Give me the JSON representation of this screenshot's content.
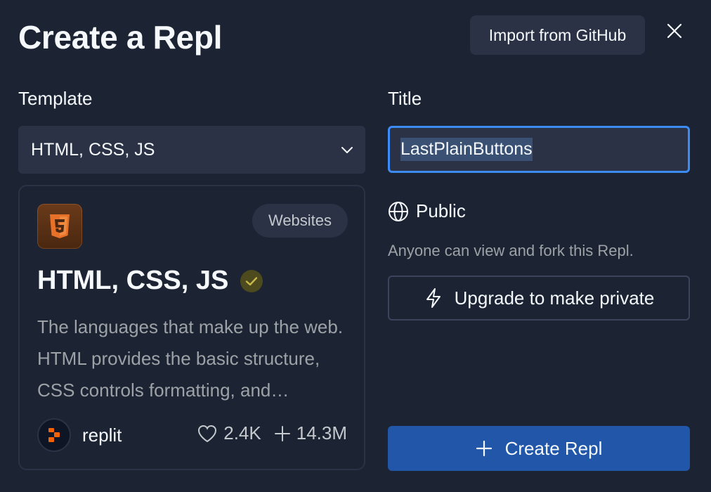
{
  "dialog": {
    "title": "Create a Repl",
    "import_label": "Import from GitHub",
    "close_icon": "close-icon"
  },
  "template": {
    "label": "Template",
    "selected": "HTML, CSS, JS"
  },
  "title_field": {
    "label": "Title",
    "value": "LastPlainButtons"
  },
  "card": {
    "icon": "html5-icon",
    "badge": "Websites",
    "name": "HTML, CSS, JS",
    "verified_icon": "verified-check-icon",
    "description": "The languages that make up the web. HTML provides the basic structure, CSS controls formatting, and JavaScript controls the behavior of different elements.",
    "author": "replit",
    "likes": "2.4K",
    "forks": "14.3M"
  },
  "privacy": {
    "label": "Public",
    "description": "Anyone can view and fork this Repl.",
    "upgrade_label": "Upgrade to make private"
  },
  "create": {
    "label": "Create Repl"
  },
  "colors": {
    "background": "#1c2333",
    "surface": "#2b3245",
    "accent": "#3d8bf5",
    "primary_button": "#2156a8"
  }
}
